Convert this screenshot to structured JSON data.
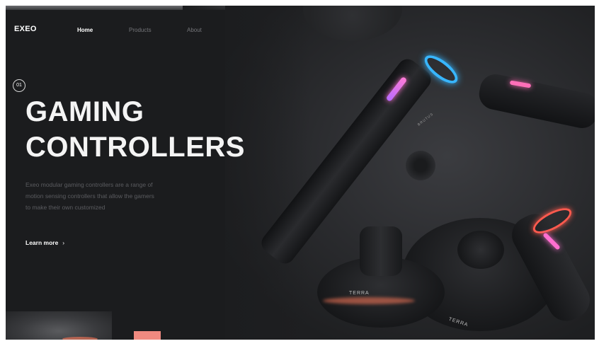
{
  "nav": {
    "logo": "EXEO",
    "links": [
      {
        "label": "Home",
        "active": true
      },
      {
        "label": "Products",
        "active": false
      },
      {
        "label": "About",
        "active": false
      }
    ]
  },
  "hero": {
    "slide_number": "01",
    "title_line1": "GAMING",
    "title_line2": "CONTROLLERS",
    "description_line1": "Exeo modular gaming controllers are a range of",
    "description_line2": "motion sensing controllers that allow the gamers",
    "description_line3": "to make their own customized",
    "cta_label": "Learn more",
    "cta_icon": "chevron-right-icon"
  },
  "product": {
    "dock_brand_a": "TERRA",
    "dock_brand_b": "TERRA",
    "stick_brand": "BRUTUS"
  },
  "colors": {
    "background": "#1b1c1e",
    "accent": "#f08a80",
    "ring_blue": "#38b6ff",
    "glow_pink": "#ff6fd0",
    "ring_red": "#ff5a4e"
  }
}
